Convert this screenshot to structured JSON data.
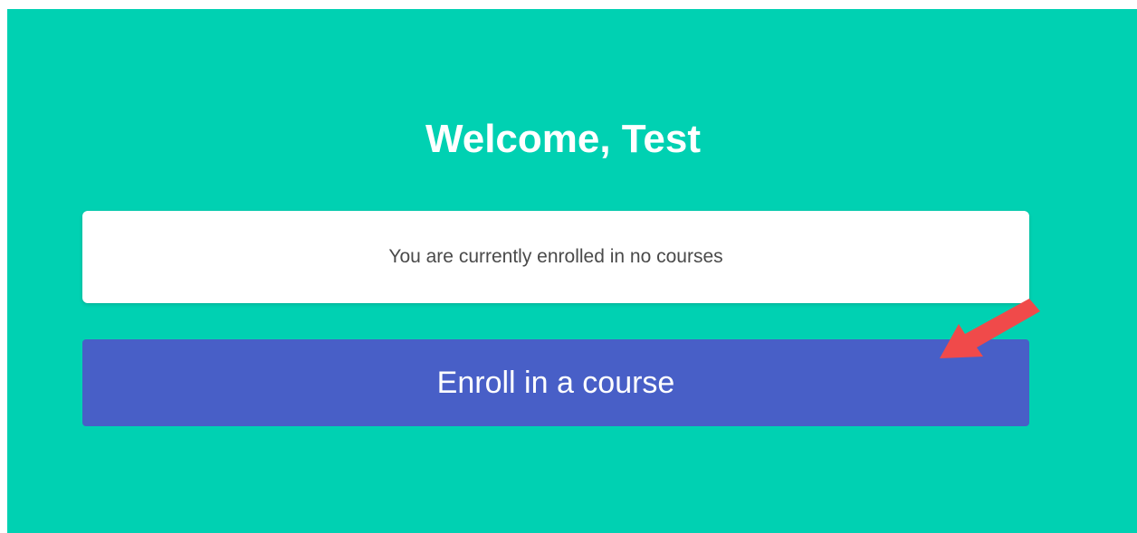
{
  "hero": {
    "title": "Welcome, Test",
    "background_color": "#00d1b2"
  },
  "notice": {
    "text": "You are currently enrolled in no courses"
  },
  "enroll": {
    "label": "Enroll in a course",
    "color": "#485fc7"
  },
  "annotation": {
    "arrow_color": "#f04a4a",
    "icon": "arrow-pointer-icon"
  }
}
